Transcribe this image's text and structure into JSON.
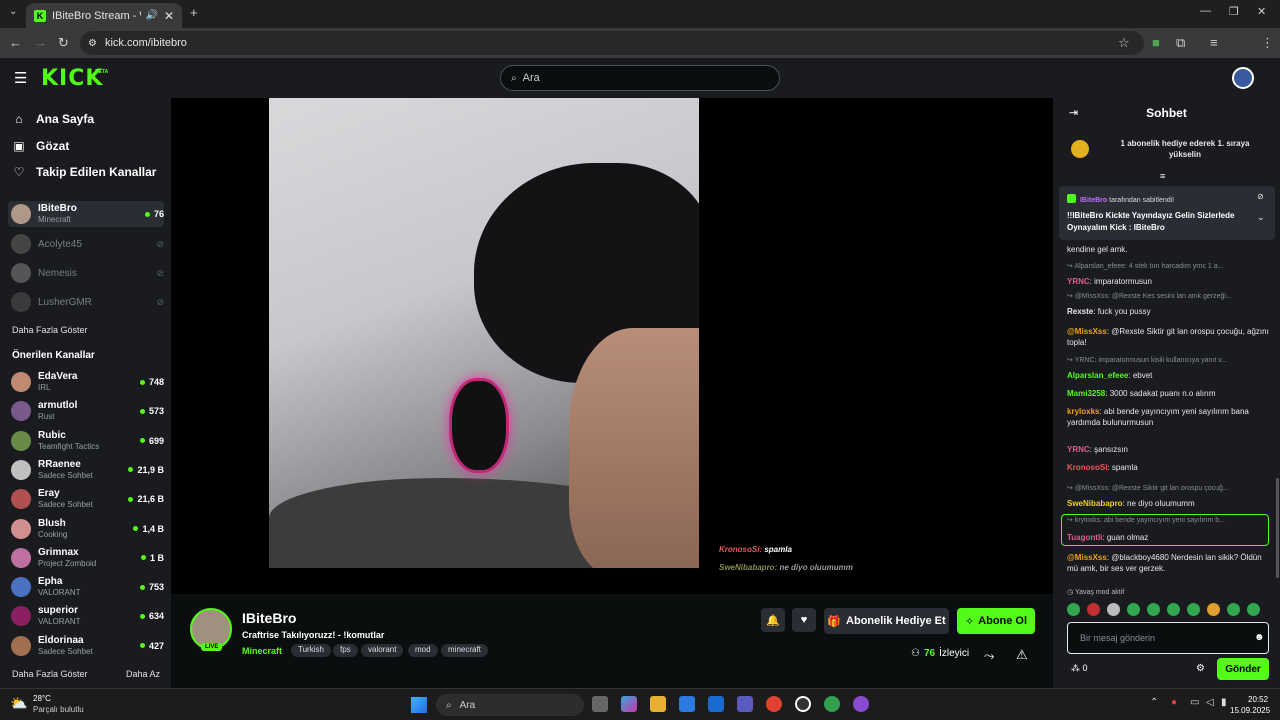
{
  "browser": {
    "tab_title": "IBiteBro Stream - Watch Li...",
    "url": "kick.com/ibitebro"
  },
  "kick": {
    "logo": "KICK",
    "beta": "BETA",
    "search_placeholder": "Ara"
  },
  "sidebar": {
    "nav": [
      {
        "label": "Ana Sayfa"
      },
      {
        "label": "Gözat"
      },
      {
        "label": "Takip Edilen Kanallar"
      }
    ],
    "followed": [
      {
        "name": "IBiteBro",
        "category": "Minecraft",
        "viewers": "76",
        "live": true
      },
      {
        "name": "Acolyte45",
        "live": false
      },
      {
        "name": "Nemesis",
        "live": false
      },
      {
        "name": "LusherGMR",
        "live": false
      }
    ],
    "show_more": "Daha Fazla Göster",
    "recommended_title": "Önerilen Kanallar",
    "recommended": [
      {
        "name": "EdaVera",
        "category": "IRL",
        "viewers": "748",
        "color": "#c08a70"
      },
      {
        "name": "armutlol",
        "category": "Rust",
        "viewers": "573",
        "color": "#7a5a8a"
      },
      {
        "name": "Rubic",
        "category": "Teamfight Tactics",
        "viewers": "699",
        "color": "#6a8a4a"
      },
      {
        "name": "RRaenee",
        "category": "Sadece Sohbet",
        "viewers": "21,9 B",
        "color": "#c0c0c0"
      },
      {
        "name": "Eray",
        "category": "Sadece Sohbet",
        "viewers": "21,6 B",
        "color": "#b05050"
      },
      {
        "name": "Blush",
        "category": "Cooking",
        "viewers": "1,4 B",
        "color": "#d09090"
      },
      {
        "name": "Grimnax",
        "category": "Project Zomboid",
        "viewers": "1 B",
        "color": "#c070a0"
      },
      {
        "name": "Epha",
        "category": "VALORANT",
        "viewers": "753",
        "color": "#4a70c0"
      },
      {
        "name": "superior",
        "category": "VALORANT",
        "viewers": "634",
        "color": "#8a2060"
      },
      {
        "name": "Eldorinaa",
        "category": "Sadece Sohbet",
        "viewers": "427",
        "color": "#a07050"
      }
    ],
    "show_more_bottom": "Daha Fazla Göster",
    "show_less": "Daha Az"
  },
  "video": {
    "overlay_msg1_user": "KronosoSi:",
    "overlay_msg1_text": "spamla",
    "overlay_msg2_user": "SweNibabapro:",
    "overlay_msg2_text": "ne diyo oluumumm"
  },
  "stream": {
    "streamer": "IBiteBro",
    "live_badge": "LIVE",
    "title": "Craftrise Takılıyoruzz! - !komutlar",
    "category": "Minecraft",
    "tags": [
      "Turkish",
      "fps",
      "valorant",
      "mod",
      "minecraft"
    ],
    "gift_button": "Abonelik Hediye Et",
    "subscribe_button": "Abone Ol",
    "viewer_count": "76",
    "viewer_label": "İzleyici"
  },
  "chat": {
    "title": "Sohbet",
    "leaderboard_text": "1 abonelik hediye ederek 1. sıraya yükselin",
    "pinned_by_user": "IBiteBro",
    "pinned_by_suffix": "tarafından sabitlendi!",
    "pinned_text": "!!IBiteBro Kickte Yayındayız Gelin Sizlerlede Oynayalım Kick : IBiteBro",
    "messages": [
      {
        "type": "text",
        "text": "kendine gel amk."
      },
      {
        "type": "reply",
        "text": "Alparslan_efeee: 4 stek tıırı harcadım yrnc 1 a..."
      },
      {
        "type": "msg",
        "user": "YRNC",
        "color": "#e85a8a",
        "text": "imparatormusun"
      },
      {
        "type": "reply",
        "text": "@MissXss: @Rexste Kes sesini lan amk gerzeği..."
      },
      {
        "type": "msg",
        "user": "Rexste",
        "color": "#e8e8e8",
        "text": "fuck you pussy"
      },
      {
        "type": "msg",
        "user": "@MissXss",
        "color": "#f0a020",
        "text": "@Rexste Siktir git lan orospu çocuğu, ağzını topla!"
      },
      {
        "type": "reply",
        "text": "YRNC: imparatormusun kisili kullanıcıya yanıt v..."
      },
      {
        "type": "msg",
        "user": "Alparslan_efeee",
        "color": "#53fc18",
        "text": "ebvet"
      },
      {
        "type": "msg",
        "user": "Mami3258",
        "color": "#53fc18",
        "text": "3000 sadakat puanı n.o alırım"
      },
      {
        "type": "msg",
        "user": "kryloxks",
        "color": "#f0a020",
        "text": "abi bende yayıncıyım yeni sayılırım bana yardımda bulunurmusun"
      },
      {
        "type": "msg",
        "user": "YRNC",
        "color": "#e85a8a",
        "text": "şansızsın"
      },
      {
        "type": "msg",
        "user": "KronosoSi",
        "color": "#e85a5a",
        "text": "spamla"
      },
      {
        "type": "reply",
        "text": "@MissXss: @Rexste Siktir git lan orospu çocuğ..."
      },
      {
        "type": "msg",
        "user": "SweNibabapro",
        "color": "#f0d020",
        "text": "ne diyo oluumumm"
      },
      {
        "type": "reply",
        "text": "kryloxks: abi bende yayıncıyım yeni sayılırım b..."
      },
      {
        "type": "msg",
        "user": "Tuagontli",
        "color": "#e85a8a",
        "text": "guan olmaz"
      },
      {
        "type": "msg",
        "user": "@MissXss",
        "color": "#f0a020",
        "text": "@blackboy4680 Nerdesin lan sikik? Öldün mü amk, bir ses ver gerzek."
      }
    ],
    "slow_mode": "Yavaş mod aktif",
    "input_placeholder": "Bir mesaj gönderin",
    "points": "0",
    "send_button": "Gönder"
  },
  "taskbar": {
    "weather_temp": "28°C",
    "weather_desc": "Parçalı bulutlu",
    "search_placeholder": "Ara",
    "time": "20:52",
    "date": "15.09.2025"
  }
}
